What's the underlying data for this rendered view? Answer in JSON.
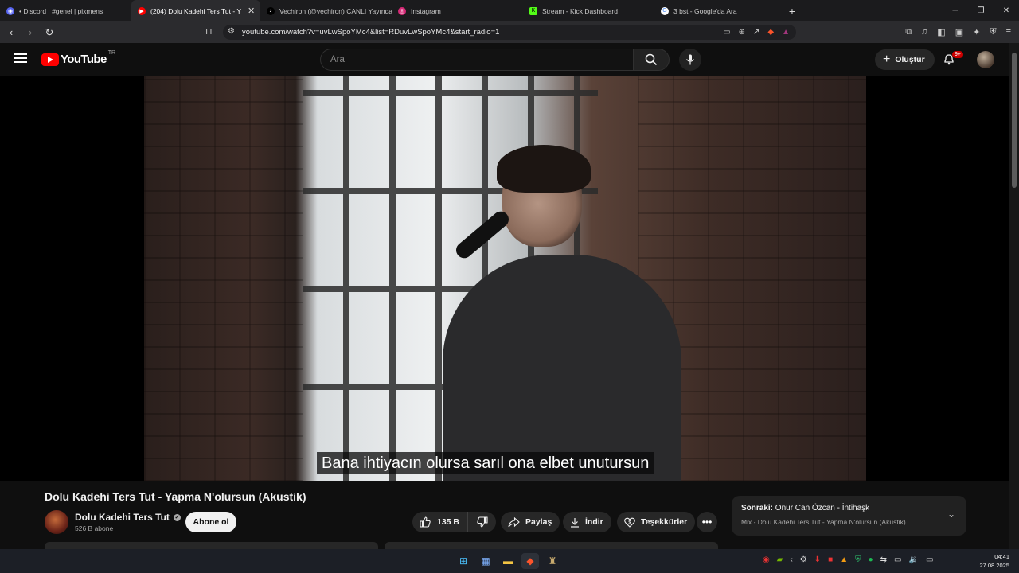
{
  "browser": {
    "tabs": [
      {
        "label": "• Discord | #genel | pixmens",
        "fav_color": "#5865f2",
        "fav_glyph": "◉"
      },
      {
        "label": "(204) Dolu Kadehi Ters Tut - Y",
        "fav_color": "#ff0000",
        "fav_glyph": "▶"
      },
      {
        "label": "Vechiron (@vechiron) CANLI Yayında",
        "fav_color": "#000000",
        "fav_glyph": "♪"
      },
      {
        "label": "Instagram",
        "fav_color": "#d62976",
        "fav_glyph": "◎"
      },
      {
        "label": "Stream - Kick Dashboard",
        "fav_color": "#53fc18",
        "fav_glyph": "K"
      },
      {
        "label": "3 bst - Google'da Ara",
        "fav_color": "#ffffff",
        "fav_glyph": "G"
      }
    ],
    "url": "youtube.com/watch?v=uvLwSpoYMc4&list=RDuvLwSpoYMc4&start_radio=1"
  },
  "header": {
    "logo_word": "YouTube",
    "country_code": "TR",
    "search_placeholder": "Ara",
    "create_label": "Oluştur",
    "notif_badge": "9+"
  },
  "video": {
    "subtitle": "Bana ihtiyacın olursa sarıl ona elbet unutursun",
    "title": "Dolu Kadehi Ters Tut - Yapma N'olursun (Akustik)"
  },
  "channel": {
    "name": "Dolu Kadehi Ters Tut",
    "subscribers": "526 B abone",
    "subscribe_label": "Abone ol"
  },
  "actions": {
    "likes": "135 B",
    "share": "Paylaş",
    "download": "İndir",
    "thanks": "Teşekkürler"
  },
  "up_next": {
    "prefix": "Sonraki:",
    "title": "Onur Can Özcan - İntihaşk",
    "subtitle": "Mix - Dolu Kadehi Ters Tut - Yapma N'olursun (Akustik)"
  },
  "taskbar": {
    "time": "04:41",
    "date": "27.08.2025"
  }
}
